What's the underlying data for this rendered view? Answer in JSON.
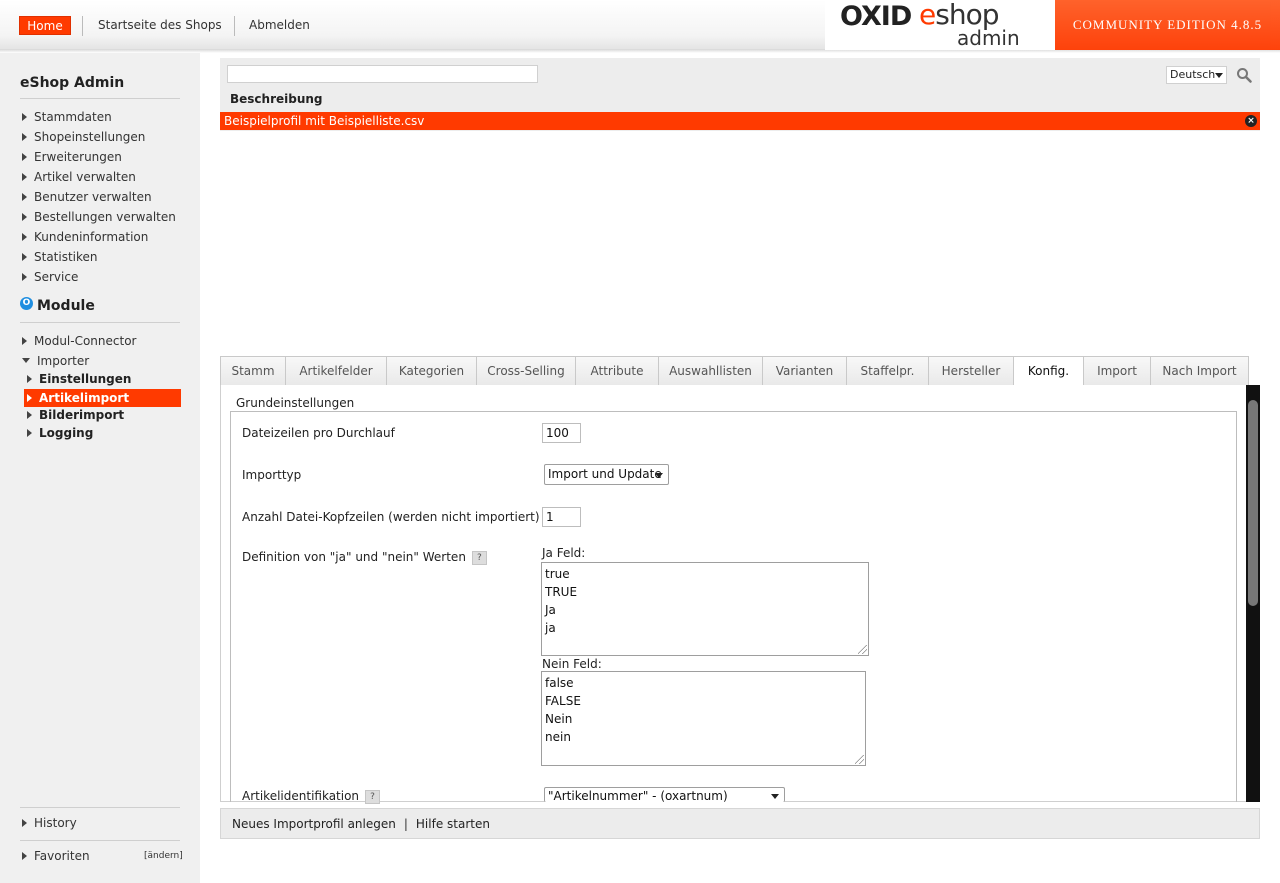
{
  "header": {
    "nav": {
      "home": "Home",
      "shop_start": "Startseite des Shops",
      "logout": "Abmelden"
    },
    "logo": {
      "brand_bold": "OXID",
      "brand_e": "e",
      "brand_shop": "shop",
      "brand_admin": "admin"
    },
    "edition": "COMMUNITY EDITION 4.8.5",
    "colors": {
      "accent": "#ff3a00"
    }
  },
  "sidebar": {
    "title": "eShop Admin",
    "items": [
      {
        "label": "Stammdaten"
      },
      {
        "label": "Shopeinstellungen"
      },
      {
        "label": "Erweiterungen"
      },
      {
        "label": "Artikel verwalten"
      },
      {
        "label": "Benutzer verwalten"
      },
      {
        "label": "Bestellungen verwalten"
      },
      {
        "label": "Kundeninformation"
      },
      {
        "label": "Statistiken"
      },
      {
        "label": "Service"
      }
    ],
    "module_title": "Module",
    "module_icon": "O",
    "module_items": [
      {
        "label": "Modul-Connector"
      },
      {
        "label": "Importer"
      }
    ],
    "importer_sub": [
      {
        "label": "Einstellungen"
      },
      {
        "label": "Artikelimport"
      },
      {
        "label": "Bilderimport"
      },
      {
        "label": "Logging"
      }
    ],
    "history": "History",
    "favorites": "Favoriten",
    "favorites_edit": "[ändern]"
  },
  "list": {
    "search_value": "",
    "language": "Deutsch",
    "column_header": "Beschreibung",
    "selected_row": "Beispielprofil mit Beispielliste.csv",
    "close_icon": "×"
  },
  "tabs": [
    {
      "label": "Stamm"
    },
    {
      "label": "Artikelfelder"
    },
    {
      "label": "Kategorien"
    },
    {
      "label": "Cross-Selling"
    },
    {
      "label": "Attribute"
    },
    {
      "label": "Auswahllisten"
    },
    {
      "label": "Varianten"
    },
    {
      "label": "Staffelpr."
    },
    {
      "label": "Hersteller"
    },
    {
      "label": "Konfig."
    },
    {
      "label": "Import"
    },
    {
      "label": "Nach Import"
    }
  ],
  "active_tab": "Konfig.",
  "form": {
    "legend": "Grundeinstellungen",
    "rows_per_pass_label": "Dateizeilen pro Durchlauf",
    "rows_per_pass_value": "100",
    "import_type_label": "Importtyp",
    "import_type_value": "Import und Update",
    "header_rows_label": "Anzahl Datei-Kopfzeilen (werden nicht importiert)",
    "header_rows_value": "1",
    "yes_no_label": "Definition von \"ja\" und \"nein\" Werten",
    "help_icon": "?",
    "yes_field_label": "Ja Feld:",
    "yes_values": [
      "true",
      "TRUE",
      "Ja",
      "ja"
    ],
    "no_field_label": "Nein Feld:",
    "no_values": [
      "false",
      "FALSE",
      "Nein",
      "nein"
    ],
    "article_id_label": "Artikelidentifikation",
    "article_id_value": "\"Artikelnummer\" - (oxartnum)"
  },
  "actions": {
    "new_profile": "Neues Importprofil anlegen",
    "separator": "|",
    "help": "Hilfe starten"
  }
}
